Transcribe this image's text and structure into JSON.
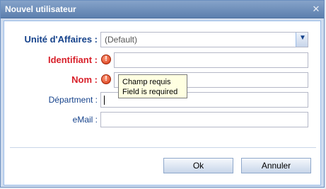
{
  "dialog": {
    "title": "Nouvel utilisateur",
    "close_glyph": "✕"
  },
  "form": {
    "business_unit": {
      "label": "Unité d'Affaires :",
      "value": "(Default)"
    },
    "identifier": {
      "label": "Identifiant :",
      "value": "",
      "error_glyph": "!"
    },
    "name": {
      "label": "Nom :",
      "value": "",
      "error_glyph": "!"
    },
    "department": {
      "label": "Départment :",
      "value": ""
    },
    "email": {
      "label": "eMail :",
      "value": ""
    }
  },
  "tooltip": {
    "line1": "Champ requis",
    "line2": "Field is required"
  },
  "buttons": {
    "ok_label": "Ok",
    "cancel_label": "Annuler"
  },
  "colors": {
    "label_color": "#15428b",
    "required_color": "#d8202a",
    "titlebar": "#5c7fae"
  },
  "icons": {
    "dropdown": "chevron-down-icon",
    "error": "error-icon",
    "close": "close-icon"
  }
}
